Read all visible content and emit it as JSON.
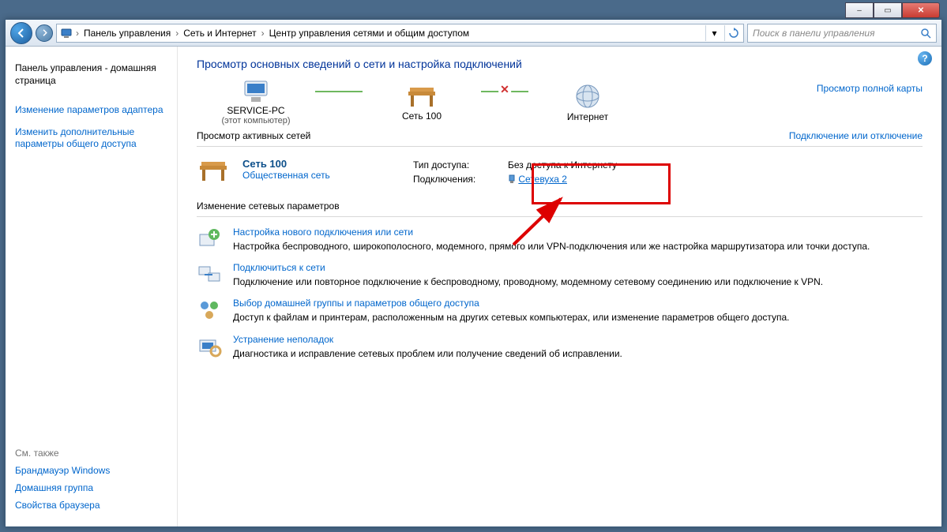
{
  "window_buttons": {
    "min": "–",
    "max": "▭",
    "close": "✕"
  },
  "breadcrumb": {
    "items": [
      "Панель управления",
      "Сеть и Интернет",
      "Центр управления сетями и общим доступом"
    ]
  },
  "search": {
    "placeholder": "Поиск в панели управления"
  },
  "sidebar": {
    "home": "Панель управления - домашняя страница",
    "links": [
      "Изменение параметров адаптера",
      "Изменить дополнительные параметры общего доступа"
    ],
    "see_also_head": "См. также",
    "see_also": [
      "Брандмауэр Windows",
      "Домашняя группа",
      "Свойства браузера"
    ]
  },
  "main": {
    "title": "Просмотр основных сведений о сети и настройка подключений",
    "full_map": "Просмотр полной карты",
    "map": {
      "pc": "SERVICE-PC",
      "pc_sub": "(этот компьютер)",
      "net": "Сеть 100",
      "internet": "Интернет"
    },
    "active_nets_label": "Просмотр активных сетей",
    "connect_link": "Подключение или отключение",
    "active_net": {
      "name": "Сеть 100",
      "type": "Общественная сеть",
      "access_type_k": "Тип доступа:",
      "access_type_v": "Без доступа к Интернету",
      "conn_k": "Подключения:",
      "conn_v": "Сетевуха 2"
    },
    "change_params": "Изменение сетевых параметров",
    "tasks": [
      {
        "t": "Настройка нового подключения или сети",
        "d": "Настройка беспроводного, широкополосного, модемного, прямого или VPN-подключения или же настройка маршрутизатора или точки доступа."
      },
      {
        "t": "Подключиться к сети",
        "d": "Подключение или повторное подключение к беспроводному, проводному, модемному сетевому соединению или подключение к VPN."
      },
      {
        "t": "Выбор домашней группы и параметров общего доступа",
        "d": "Доступ к файлам и принтерам, расположенным на других сетевых компьютерах, или изменение параметров общего доступа."
      },
      {
        "t": "Устранение неполадок",
        "d": "Диагностика и исправление сетевых проблем или получение сведений об исправлении."
      }
    ]
  }
}
